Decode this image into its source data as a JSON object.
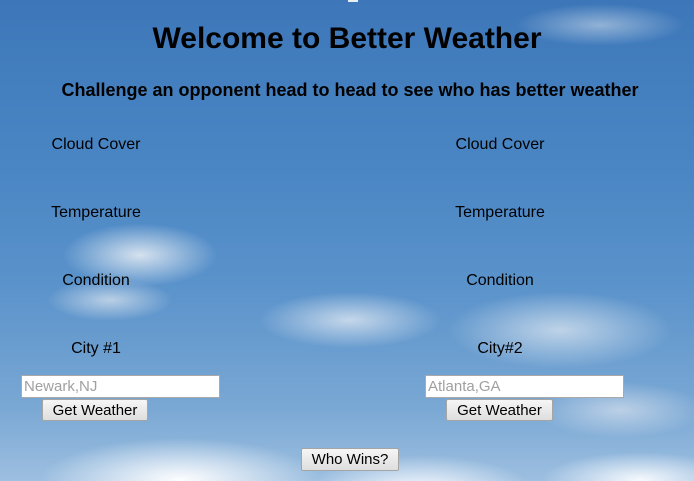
{
  "header": {
    "title": "Welcome to Better Weather",
    "subtitle": "Challenge an opponent head to head to see who has better weather"
  },
  "left": {
    "cloud_cover_label": "Cloud Cover",
    "temperature_label": "Temperature",
    "condition_label": "Condition",
    "city_label": "City #1",
    "city_input": {
      "value": "",
      "placeholder": "Newark,NJ"
    },
    "get_weather_label": "Get Weather"
  },
  "right": {
    "cloud_cover_label": "Cloud Cover",
    "temperature_label": "Temperature",
    "condition_label": "Condition",
    "city_label": "City#2",
    "city_input": {
      "value": "",
      "placeholder": "Atlanta,GA"
    },
    "get_weather_label": "Get Weather"
  },
  "footer": {
    "who_wins_label": "Who Wins?"
  },
  "colors": {
    "sky": "#4a86c4",
    "text": "#000000"
  }
}
